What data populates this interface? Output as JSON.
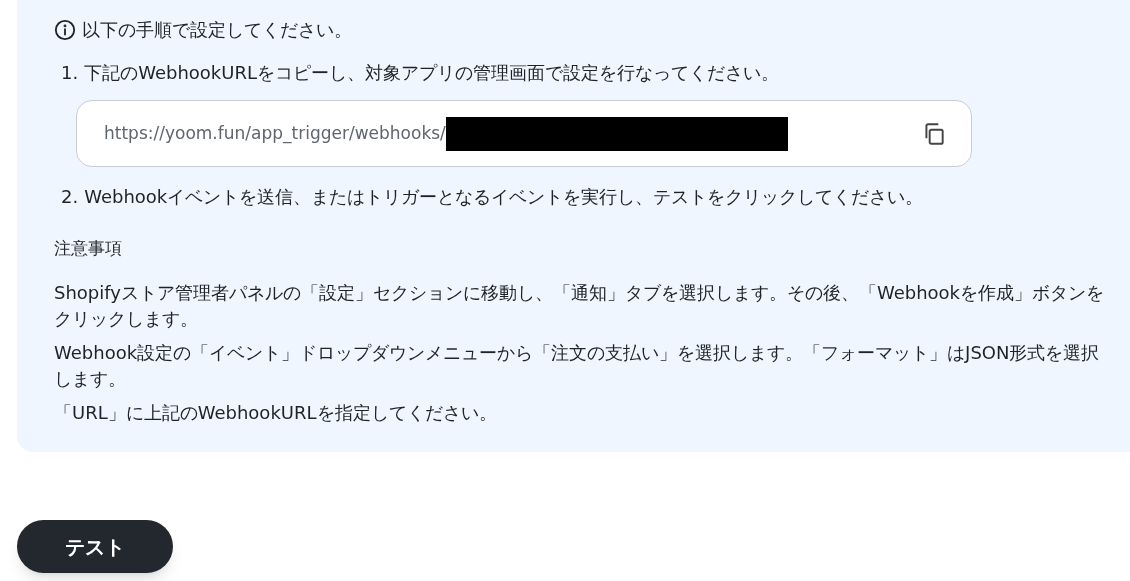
{
  "instructions": {
    "heading": "以下の手順で設定してください。",
    "steps": [
      {
        "number": "1.",
        "text": "下記のWebhookURLをコピーし、対象アプリの管理画面で設定を行なってください。",
        "url_field": {
          "value": "https://yoom.fun/app_trigger/webhooks/",
          "redacted": true
        }
      },
      {
        "number": "2.",
        "text": "Webhookイベントを送信、またはトリガーとなるイベントを実行し、テストをクリックしてください。"
      }
    ],
    "notes_title": "注意事項",
    "notes": [
      "Shopifyストア管理者パネルの「設定」セクションに移動し、「通知」タブを選択します。その後、「Webhookを作成」ボタンをクリックします。",
      "Webhook設定の「イベント」ドロップダウンメニューから「注文の支払い」を選択します。「フォーマット」はJSON形式を選択します。",
      "「URL」に上記のWebhookURLを指定してください。"
    ]
  },
  "test_button": {
    "label": "テスト"
  }
}
